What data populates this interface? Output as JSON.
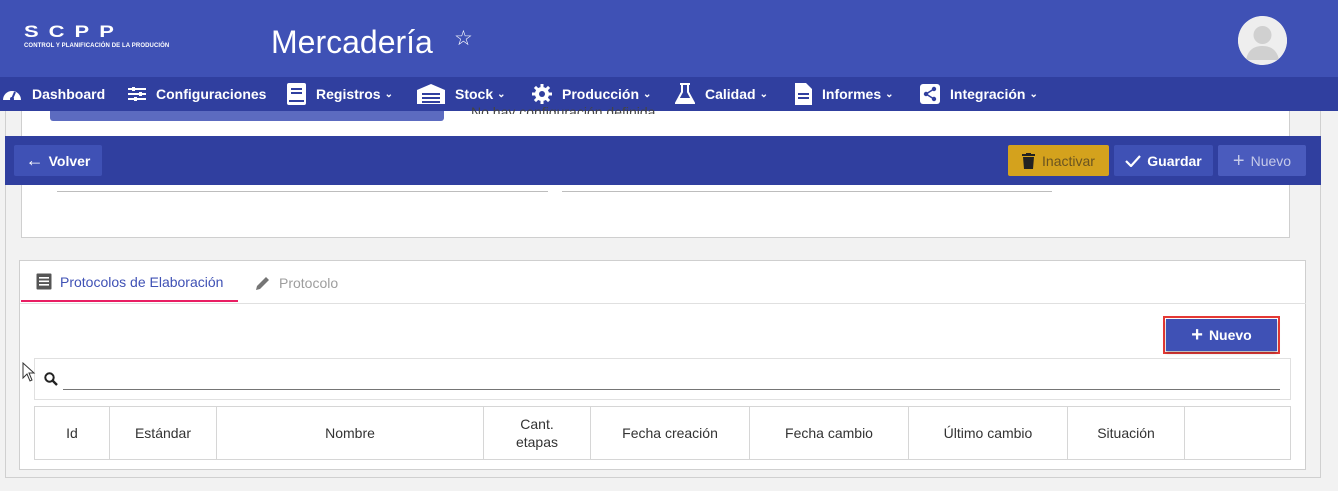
{
  "header": {
    "logo_main": "SCPP",
    "logo_sub": "CONTROL Y PLANIFICACIÓN DE LA PRODUCIÓN",
    "title": "Mercadería",
    "star_icon": "star-outline-icon",
    "avatar_icon": "user-avatar-icon"
  },
  "nav": {
    "items": [
      {
        "label": "Dashboard",
        "icon": "dashboard-gauge-icon",
        "dropdown": false
      },
      {
        "label": "Configuraciones",
        "icon": "sliders-icon",
        "dropdown": false
      },
      {
        "label": "Registros",
        "icon": "book-icon",
        "dropdown": true
      },
      {
        "label": "Stock",
        "icon": "warehouse-icon",
        "dropdown": true
      },
      {
        "label": "Producción",
        "icon": "cog-icon",
        "dropdown": true
      },
      {
        "label": "Calidad",
        "icon": "flask-icon",
        "dropdown": true
      },
      {
        "label": "Informes",
        "icon": "document-icon",
        "dropdown": true
      },
      {
        "label": "Integración",
        "icon": "share-icon",
        "dropdown": true
      }
    ]
  },
  "form": {
    "partial_text": "No hay configuración definida"
  },
  "toolbar": {
    "volver_label": "Volver",
    "inactivar_label": "Inactivar",
    "guardar_label": "Guardar",
    "nuevo_label": "Nuevo"
  },
  "tabs": [
    {
      "label": "Protocolos de Elaboración",
      "icon": "list-doc-icon",
      "active": true
    },
    {
      "label": "Protocolo",
      "icon": "pencil-icon",
      "active": false
    }
  ],
  "protocols": {
    "new_button_label": "Nuevo",
    "search_value": "",
    "columns": [
      "Id",
      "Estándar",
      "Nombre",
      "Cant.\netapas",
      "Fecha creación",
      "Fecha cambio",
      "Último cambio",
      "Situación",
      ""
    ]
  },
  "colors": {
    "header": "#3f51b5",
    "nav": "#303f9f",
    "accent_tab": "#e91e63",
    "warning": "#d4a21d",
    "highlight_border": "#e53935"
  }
}
